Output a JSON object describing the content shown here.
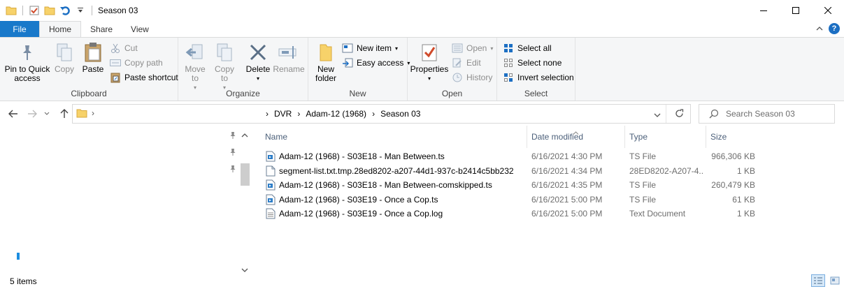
{
  "window": {
    "title": "Season 03",
    "minimize_glyph": "—",
    "maximize_glyph": "☐",
    "close_glyph": "✕"
  },
  "quick_access_icons": [
    "folder-icon",
    "properties-check-icon",
    "new-folder-icon",
    "undo-icon",
    "customize-dropdown-icon"
  ],
  "tabs": [
    "File",
    "Home",
    "Share",
    "View"
  ],
  "ribbon": {
    "clipboard": {
      "label": "Clipboard",
      "pin": "Pin to Quick access",
      "copy": "Copy",
      "paste": "Paste",
      "cut": "Cut",
      "copy_path": "Copy path",
      "paste_shortcut": "Paste shortcut"
    },
    "organize": {
      "label": "Organize",
      "move_to": "Move to",
      "copy_to": "Copy to",
      "delete": "Delete",
      "rename": "Rename"
    },
    "new": {
      "label": "New",
      "new_folder": "New folder",
      "new_item": "New item",
      "easy_access": "Easy access"
    },
    "open": {
      "label": "Open",
      "properties": "Properties",
      "open": "Open",
      "edit": "Edit",
      "history": "History"
    },
    "select": {
      "label": "Select",
      "select_all": "Select all",
      "select_none": "Select none",
      "invert_selection": "Invert selection"
    }
  },
  "address": {
    "crumbs": [
      "DVR",
      "Adam-12 (1968)",
      "Season 03"
    ],
    "search_placeholder": "Search Season 03"
  },
  "columns": {
    "name": "Name",
    "date": "Date modified",
    "type": "Type",
    "size": "Size"
  },
  "files": [
    {
      "name": "Adam-12 (1968) - S03E18 - Man Between.ts",
      "date": "6/16/2021 4:30 PM",
      "type": "TS File",
      "size": "966,306 KB",
      "icon": "ts-file-icon"
    },
    {
      "name": "segment-list.txt.tmp.28ed8202-a207-44d1-937c-b2414c5bb232",
      "date": "6/16/2021 4:34 PM",
      "type": "28ED8202-A207-4...",
      "size": "1 KB",
      "icon": "blank-file-icon"
    },
    {
      "name": "Adam-12 (1968) - S03E18 - Man Between-comskipped.ts",
      "date": "6/16/2021 4:35 PM",
      "type": "TS File",
      "size": "260,479 KB",
      "icon": "ts-file-icon"
    },
    {
      "name": "Adam-12 (1968) - S03E19 - Once a Cop.ts",
      "date": "6/16/2021 5:00 PM",
      "type": "TS File",
      "size": "61 KB",
      "icon": "ts-file-icon"
    },
    {
      "name": "Adam-12 (1968) - S03E19 - Once a Cop.log",
      "date": "6/16/2021 5:00 PM",
      "type": "Text Document",
      "size": "1 KB",
      "icon": "text-file-icon"
    }
  ],
  "status": {
    "item_count": "5 items"
  },
  "colors": {
    "accent": "#1979ca",
    "ribbon_bg": "#f5f6f7",
    "header_text": "#4c607a"
  }
}
